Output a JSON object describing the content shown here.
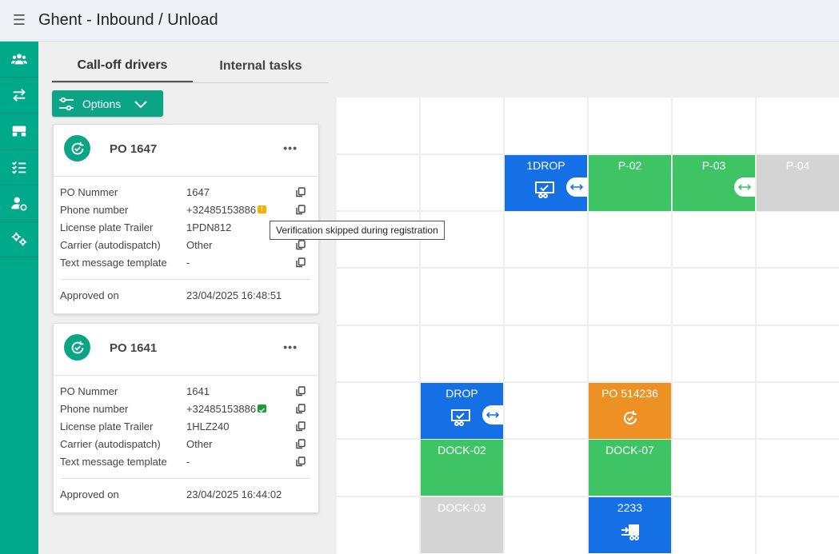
{
  "header": {
    "menu_icon": "hamburger-icon",
    "title": "Ghent - Inbound / Unload"
  },
  "sidebar": {
    "items": [
      {
        "icon": "users-icon"
      },
      {
        "icon": "transfer-arrows-icon"
      },
      {
        "icon": "dock-icon"
      },
      {
        "icon": "checklist-icon"
      },
      {
        "icon": "user-settings-icon"
      },
      {
        "icon": "gears-icon"
      }
    ]
  },
  "tabs": [
    {
      "label": "Call-off drivers",
      "active": true
    },
    {
      "label": "Internal tasks",
      "active": false
    }
  ],
  "options": {
    "label": "Options"
  },
  "cards": [
    {
      "title": "PO 1647",
      "fields": [
        {
          "label": "PO Nummer",
          "value": "1647"
        },
        {
          "label": "Phone number",
          "value": "+32485153886",
          "badge": "warning"
        },
        {
          "label": "License plate Trailer",
          "value": "1PDN812"
        },
        {
          "label": "Carrier (autodispatch)",
          "value": "Other"
        },
        {
          "label": "Text message template",
          "value": "-"
        }
      ],
      "approved_label": "Approved on",
      "approved_value": "23/04/2025 16:48:51"
    },
    {
      "title": "PO 1641",
      "fields": [
        {
          "label": "PO Nummer",
          "value": "1641"
        },
        {
          "label": "Phone number",
          "value": "+32485153886",
          "badge": "verified"
        },
        {
          "label": "License plate Trailer",
          "value": "1HLZ240"
        },
        {
          "label": "Carrier (autodispatch)",
          "value": "Other"
        },
        {
          "label": "Text message template",
          "value": "-"
        }
      ],
      "approved_label": "Approved on",
      "approved_value": "23/04/2025 16:44:02"
    }
  ],
  "tooltip": {
    "text": "Verification skipped during registration"
  },
  "grid": {
    "slots": {
      "drop1": {
        "label": "1DROP",
        "color": "#1570e6"
      },
      "p02": {
        "label": "P-02",
        "color": "#3ec465"
      },
      "p03": {
        "label": "P-03",
        "color": "#3ec465"
      },
      "p04": {
        "label": "P-04",
        "color": "#d4d4d4"
      },
      "drop": {
        "label": "DROP",
        "color": "#1570e6"
      },
      "po514236": {
        "label": "PO 514236",
        "color": "#ee9125"
      },
      "dock02": {
        "label": "DOCK-02",
        "color": "#3ec465"
      },
      "dock07": {
        "label": "DOCK-07",
        "color": "#3ec465"
      },
      "dock03": {
        "label": "DOCK-03",
        "color": "#d4d4d4"
      },
      "s2233": {
        "label": "2233",
        "color": "#1570e6"
      }
    }
  }
}
